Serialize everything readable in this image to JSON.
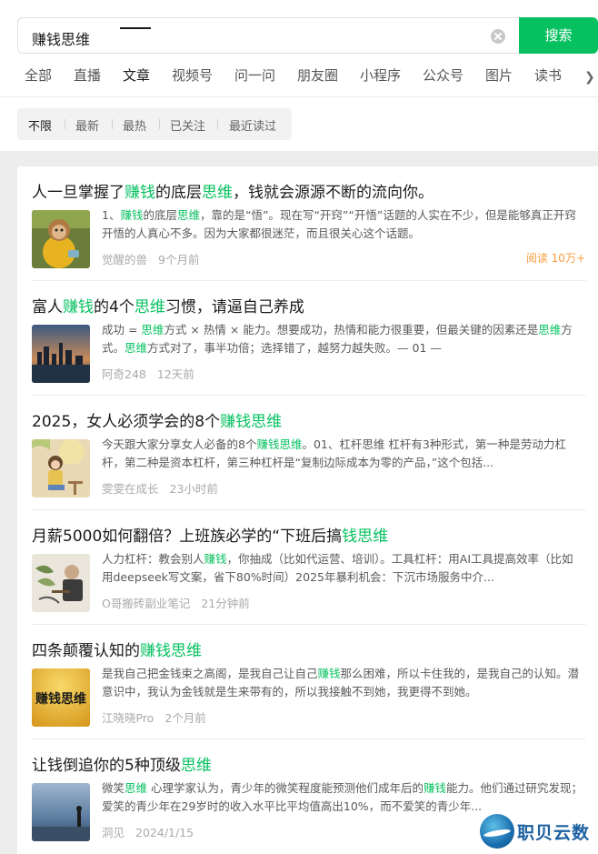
{
  "search": {
    "query": "赚钱思维",
    "button_label": "搜索"
  },
  "tabs": [
    {
      "label": "全部"
    },
    {
      "label": "直播"
    },
    {
      "label": "文章"
    },
    {
      "label": "视频号"
    },
    {
      "label": "问一问"
    },
    {
      "label": "朋友圈"
    },
    {
      "label": "小程序"
    },
    {
      "label": "公众号"
    },
    {
      "label": "图片"
    },
    {
      "label": "读书"
    }
  ],
  "active_tab": "文章",
  "filters": [
    {
      "label": "不限"
    },
    {
      "label": "最新"
    },
    {
      "label": "最热"
    },
    {
      "label": "已关注"
    },
    {
      "label": "最近读过"
    }
  ],
  "active_filter": "不限",
  "highlight_color": "#07c160",
  "results": [
    {
      "title": [
        "人一旦掌握了",
        "赚钱",
        "的底层",
        "思维",
        "，钱就会源源不断的流向你。"
      ],
      "snippet": [
        "1、",
        "赚钱",
        "的底层",
        "思维",
        "，靠的是“悟”。现在写“开窍”“开悟”话题的人实在不少，但是能够真正开窍开悟的人真心不多。因为大家都很迷茫，而且很关心这个话题。"
      ],
      "source": "觉醒的兽",
      "time": "9个月前",
      "reads": "阅读 10万+"
    },
    {
      "title": [
        "富人",
        "赚钱",
        "的4个",
        "思维",
        "习惯，请逼自己养成"
      ],
      "snippet": [
        "成功 = ",
        "思维",
        "方式 × 热情 × 能力。想要成功，热情和能力很重要，但最关键的因素还是",
        "思维",
        "方式。",
        "思维",
        "方式对了，事半功倍；选择错了，越努力越失败。— 01 —"
      ],
      "source": "阿奇248",
      "time": "12天前",
      "reads": ""
    },
    {
      "title": [
        "2025，女人必须学会的8个",
        "赚钱思维",
        ""
      ],
      "snippet": [
        "今天跟大家分享女人必备的8个",
        "赚钱思维",
        "。01、杠杆思维 杠杆有3种形式，第一种是劳动力杠杆，第二种是资本杠杆，第三种杠杆是“复制边际成本为零的产品，”这个包括..."
      ],
      "source": "雯雯在成长",
      "time": "23小时前",
      "reads": ""
    },
    {
      "title": [
        "月薪5000如何翻倍？上班族必学的“下班后搞",
        "钱思维",
        ""
      ],
      "snippet": [
        "人力杠杆：教会别人",
        "赚钱",
        "，你抽成（比如代运营、培训）。工具杠杆：用AI工具提高效率（比如用deepseek写文案，省下80%时间）2025年暴利机会：下沉市场服务中介..."
      ],
      "source": "O哥搬砖副业笔记",
      "time": "21分钟前",
      "reads": ""
    },
    {
      "title": [
        "四条颠覆认知的",
        "赚钱思维",
        ""
      ],
      "snippet": [
        "是我自己把金钱束之高阁，是我自己让自己",
        "赚钱",
        "那么困难，所以卡住我的，是我自己的认知。潜意识中，我认为金钱就是生来带有的，所以我接触不到她，我更得不到她。"
      ],
      "source": "江晓晓Pro",
      "time": "2个月前",
      "reads": "",
      "thumb_text": "赚钱思维"
    },
    {
      "title": [
        "让钱倒追你的5种顶级",
        "思维",
        ""
      ],
      "snippet": [
        "微笑",
        "思维",
        " 心理学家认为，青少年的微笑程度能预测他们成年后的",
        "赚钱",
        "能力。他们通过研究发现；爱笑的青少年在29岁时的收入水平比平均值高出10%，而不爱笑的青少年..."
      ],
      "source": "洞见",
      "time": "2024/1/15",
      "reads": ""
    }
  ],
  "watermark": {
    "text": "职贝云数"
  }
}
